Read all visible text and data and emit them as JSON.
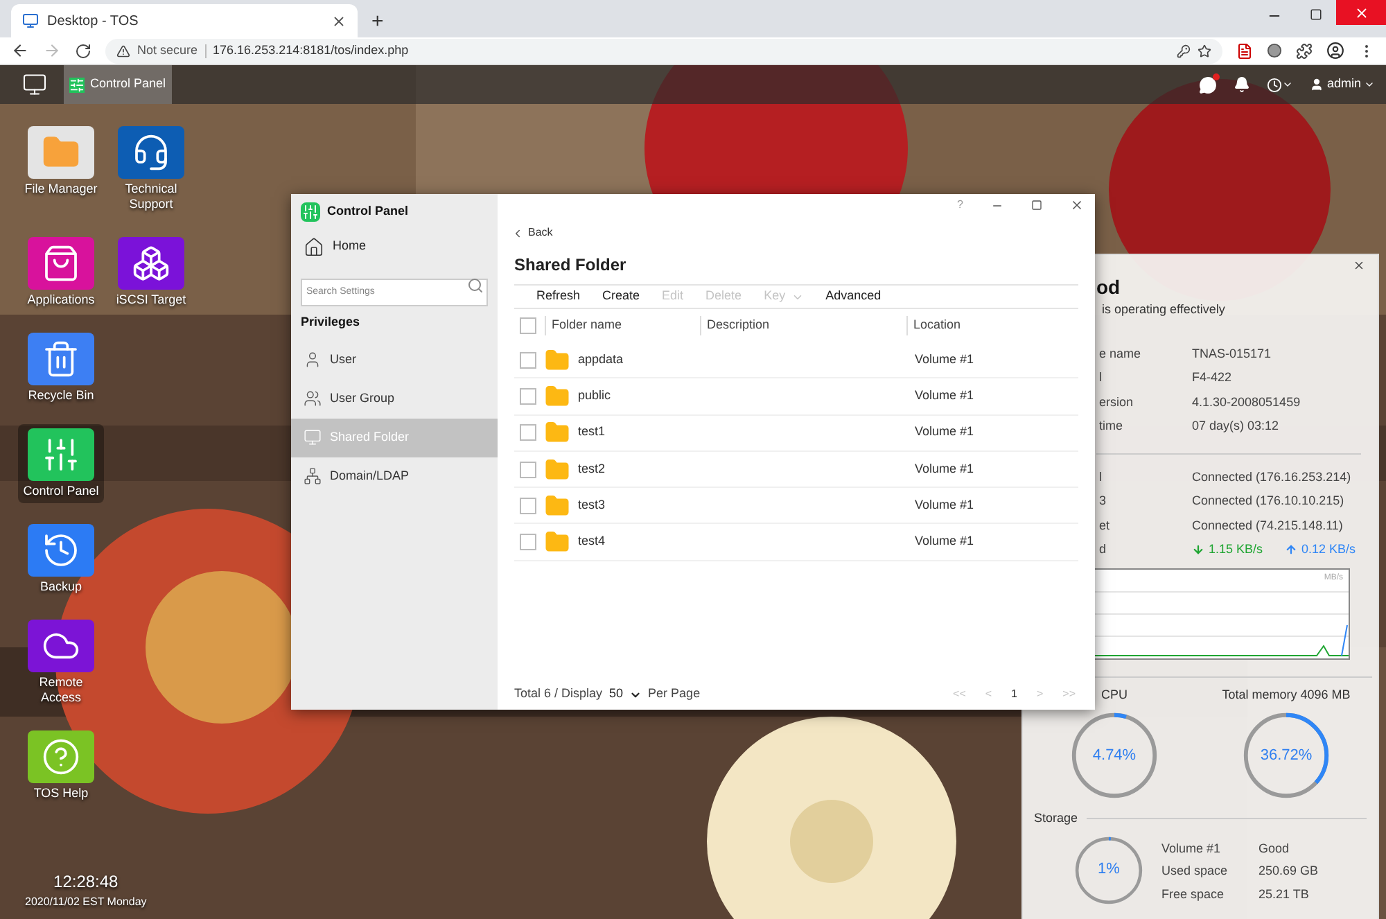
{
  "browser": {
    "tab": {
      "title": "Desktop - TOS"
    },
    "new_tab": "+",
    "address": {
      "security": "Not secure",
      "url": "176.16.253.214:8181/tos/index.php"
    }
  },
  "taskbar": {
    "apps": [
      {
        "label": "Control Panel",
        "selected": true
      }
    ],
    "user": "admin",
    "notification_dot": true
  },
  "desktop_icons": [
    {
      "label": "File Manager",
      "kind": "folder",
      "color": "#e4e4e4",
      "selected": false
    },
    {
      "label": "Technical Support",
      "kind": "support",
      "color": "#0d5db3",
      "selected": false
    },
    {
      "label": "Applications",
      "kind": "shop",
      "color": "#d8129c",
      "selected": false
    },
    {
      "label": "iSCSI Target",
      "kind": "iscsi",
      "color": "#7b12d9",
      "selected": false
    },
    {
      "label": "Recycle Bin",
      "kind": "recycle",
      "color": "#3d7ff3",
      "selected": false
    },
    {
      "label": "Control Panel",
      "kind": "control",
      "color": "#22c35c",
      "selected": true
    },
    {
      "label": "Backup",
      "kind": "backup",
      "color": "#2c7bf4",
      "selected": false
    },
    {
      "label": "Remote Access",
      "kind": "cloud",
      "color": "#7c14d6",
      "selected": false
    },
    {
      "label": "TOS Help",
      "kind": "help",
      "color": "#7bc324",
      "selected": false
    }
  ],
  "clock": {
    "time": "12:28:48",
    "date": "2020/11/02 EST Monday"
  },
  "control_panel": {
    "title": "Control Panel",
    "help": "?",
    "home": "Home",
    "search_placeholder": "Search Settings",
    "section": "Privileges",
    "nav": [
      {
        "label": "User",
        "kind": "user",
        "selected": false
      },
      {
        "label": "User Group",
        "kind": "group",
        "selected": false
      },
      {
        "label": "Shared Folder",
        "kind": "shared",
        "selected": true
      },
      {
        "label": "Domain/LDAP",
        "kind": "ldap",
        "selected": false
      }
    ],
    "back": "Back",
    "heading": "Shared Folder",
    "toolbar": [
      {
        "label": "Refresh",
        "kind": "button",
        "disabled": false
      },
      {
        "label": "Create",
        "kind": "button",
        "disabled": false
      },
      {
        "label": "Edit",
        "kind": "button",
        "disabled": true
      },
      {
        "label": "Delete",
        "kind": "button",
        "disabled": true
      },
      {
        "label": "Key",
        "kind": "menu",
        "disabled": true
      },
      {
        "label": "Advanced",
        "kind": "button",
        "disabled": false
      }
    ],
    "all_checked": false,
    "columns": [
      "Folder name",
      "Description",
      "Location"
    ],
    "rows": [
      {
        "name": "appdata",
        "location": "Volume #1",
        "checked": false
      },
      {
        "name": "public",
        "location": "Volume #1",
        "checked": false
      },
      {
        "name": "test1",
        "location": "Volume #1",
        "checked": false
      },
      {
        "name": "test2",
        "location": "Volume #1",
        "checked": false
      },
      {
        "name": "test3",
        "location": "Volume #1",
        "checked": false
      },
      {
        "name": "test4",
        "location": "Volume #1",
        "checked": false
      }
    ],
    "footer": {
      "total": "Total 6 / Display",
      "per_page_value": "50",
      "per_page": "Per Page",
      "pager": [
        {
          "label": "<<",
          "disabled": true
        },
        {
          "label": "<",
          "disabled": true
        },
        {
          "label": "1",
          "disabled": false
        },
        {
          "label": ">",
          "disabled": true
        },
        {
          "label": ">>",
          "disabled": true
        }
      ]
    }
  },
  "widget": {
    "status": "od",
    "subtitle": "is operating effectively",
    "info": [
      {
        "label": "e name",
        "value": "TNAS-015171"
      },
      {
        "label": "l",
        "value": "F4-422"
      },
      {
        "label": "ersion",
        "value": "4.1.30-2008051459"
      },
      {
        "label": "time",
        "value": "07 day(s) 03:12"
      }
    ],
    "network": [
      {
        "label": "l",
        "value": "Connected (176.16.253.214)"
      },
      {
        "label": "3",
        "value": "Connected (176.10.10.215)"
      },
      {
        "label": "et",
        "value": "Connected (74.215.148.11)"
      }
    ],
    "speed": {
      "label": "d",
      "download": "1.15 KB/s",
      "upload": "0.12 KB/s"
    },
    "chart_unit": "MB/s",
    "cpu": {
      "label": "CPU",
      "reading": "4.74%",
      "level": 0.0474
    },
    "memory": {
      "label": "Total memory 4096 MB",
      "reading": "36.72%",
      "level": 0.3672
    },
    "storage": {
      "title": "Storage",
      "reading": "1%",
      "level": 0.01,
      "rows": [
        {
          "label": "Volume #1",
          "value": "Good"
        },
        {
          "label": "Used space",
          "value": "250.69 GB"
        },
        {
          "label": "Free space",
          "value": "25.21 TB"
        }
      ]
    }
  }
}
